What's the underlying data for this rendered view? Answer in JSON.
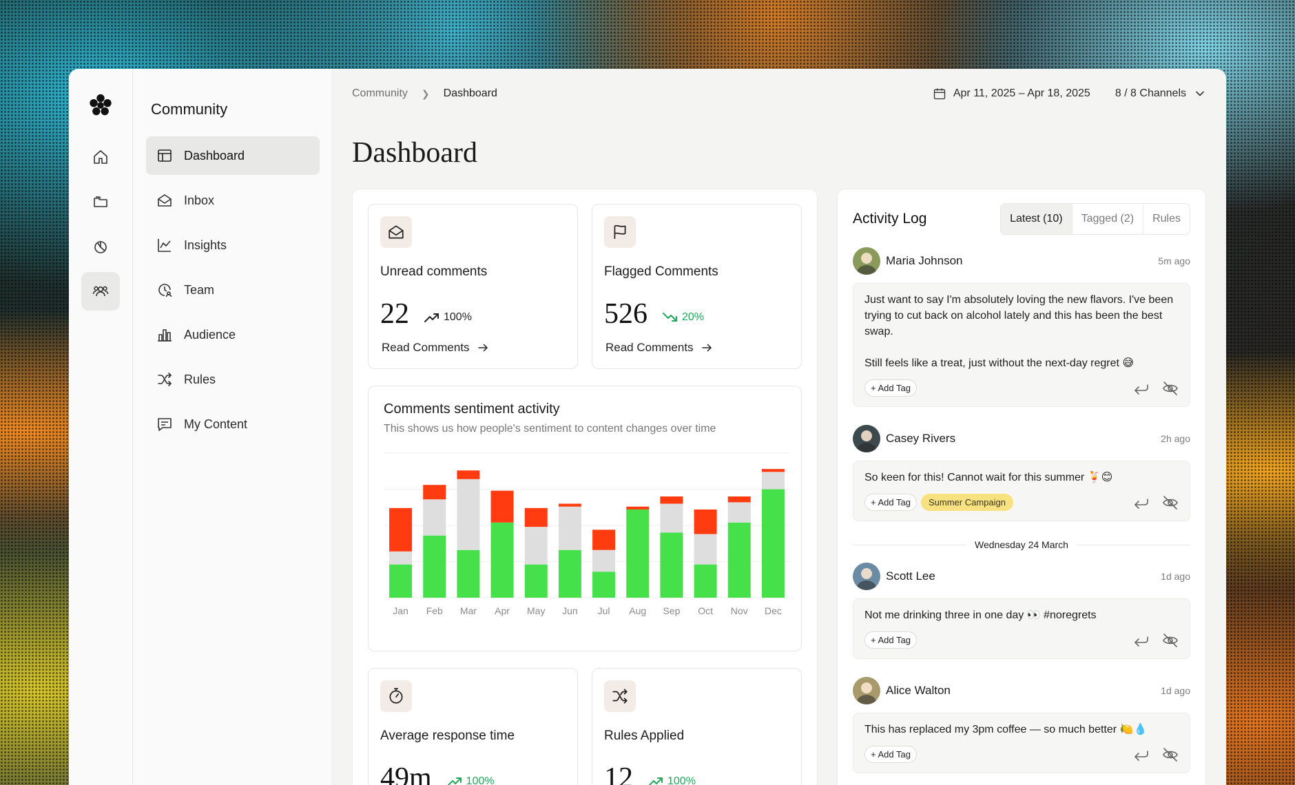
{
  "rail": {
    "items": [
      {
        "icon": "home-icon"
      },
      {
        "icon": "folders-icon"
      },
      {
        "icon": "chart-pie-icon"
      },
      {
        "icon": "users-icon",
        "active": true
      }
    ]
  },
  "nav": {
    "title": "Community",
    "items": [
      {
        "label": "Dashboard",
        "icon": "layout-icon",
        "active": true
      },
      {
        "label": "Inbox",
        "icon": "envelope-open-icon"
      },
      {
        "label": "Insights",
        "icon": "line-chart-icon"
      },
      {
        "label": "Team",
        "icon": "team-clock-icon"
      },
      {
        "label": "Audience",
        "icon": "bar-building-icon"
      },
      {
        "label": "Rules",
        "icon": "shuffle-icon"
      },
      {
        "label": "My Content",
        "icon": "message-square-icon"
      }
    ]
  },
  "topbar": {
    "breadcrumb": [
      "Community",
      "Dashboard"
    ],
    "date_range": "Apr 11, 2025 – Apr 18, 2025",
    "channels": "8 / 8 Channels"
  },
  "page_title": "Dashboard",
  "stats": {
    "unread": {
      "label": "Unread comments",
      "value": "22",
      "trend": "100%",
      "link": "Read Comments"
    },
    "flagged": {
      "label": "Flagged Comments",
      "value": "526",
      "trend": "20%",
      "link": "Read Comments"
    },
    "response": {
      "label": "Average response time",
      "value": "49m",
      "trend": "100%"
    },
    "rules": {
      "label": "Rules Applied",
      "value": "12",
      "trend": "100%"
    }
  },
  "chart": {
    "title": "Comments sentiment activity",
    "subtitle": "This shows us how people's sentiment to content changes over time"
  },
  "chart_data": {
    "type": "bar",
    "stacked": true,
    "categories": [
      "Jan",
      "Feb",
      "Mar",
      "Apr",
      "May",
      "Jun",
      "Jul",
      "Aug",
      "Sep",
      "Oct",
      "Nov",
      "Dec"
    ],
    "series": [
      {
        "color": "#46e04a",
        "values": [
          23,
          43,
          33,
          52,
          23,
          33,
          18,
          61,
          45,
          23,
          52,
          75
        ]
      },
      {
        "color": "#dedede",
        "values": [
          9,
          25,
          49,
          0,
          26,
          30,
          15,
          0,
          20,
          21,
          14,
          12
        ]
      },
      {
        "color": "#ff3b0f",
        "values": [
          30,
          10,
          6,
          22,
          13,
          2,
          14,
          2,
          5,
          17,
          4,
          2
        ]
      }
    ],
    "ylim": [
      0,
      100
    ],
    "grid": true
  },
  "activity": {
    "title": "Activity Log",
    "tabs": [
      "Latest (10)",
      "Tagged (2)",
      "Rules"
    ],
    "entries": [
      {
        "author": "Maria Johnson",
        "time": "5m ago",
        "avatar_color": "#8a9a5a",
        "message": "Just want to say I'm absolutely loving the new flavors. I've been trying to cut back on alcohol lately and this has been the best swap.\n\nStill feels like a treat, just without the next-day regret 😅",
        "add_tag": "+ Add Tag",
        "tag": ""
      },
      {
        "author": "Casey Rivers",
        "time": "2h ago",
        "avatar_color": "#3c4a4e",
        "message": "So keen for this! Cannot wait for this summer 🍹😊",
        "add_tag": "+ Add Tag",
        "tag": "Summer Campaign"
      },
      {
        "author": "Scott Lee",
        "time": "1d ago",
        "avatar_color": "#6b8aa3",
        "message": "Not me drinking three in one day 👀 #noregrets",
        "add_tag": "+ Add Tag",
        "tag": ""
      },
      {
        "author": "Alice Walton",
        "time": "1d ago",
        "avatar_color": "#a89a6a",
        "message": "This has replaced my 3pm coffee — so much better 🍋💧",
        "add_tag": "+ Add Tag",
        "tag": ""
      }
    ],
    "date_separator": "Wednesday 24 March"
  }
}
